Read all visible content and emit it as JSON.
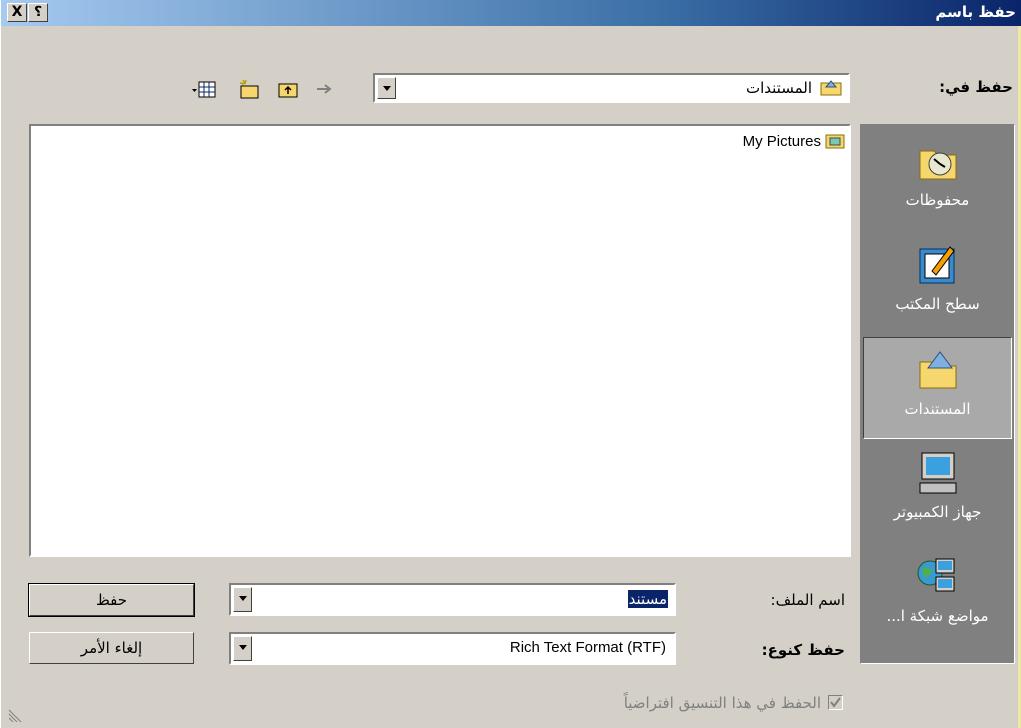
{
  "window": {
    "title": "حفظ باسم",
    "help_button": "؟",
    "close_button": "X"
  },
  "save_in": {
    "label": "حفظ في:",
    "value": "المستندات"
  },
  "files": [
    {
      "name": "My Pictures"
    }
  ],
  "places": [
    {
      "label": "محفوظات",
      "icon": "history-icon"
    },
    {
      "label": "سطح المكتب",
      "icon": "desktop-icon"
    },
    {
      "label": "المستندات",
      "icon": "my-documents-icon",
      "selected": true
    },
    {
      "label": "جهاز الكمبيوتر",
      "icon": "my-computer-icon"
    },
    {
      "label": "مواضع شبكة ا...",
      "icon": "network-places-icon"
    }
  ],
  "filename": {
    "label": "اسم الملف:",
    "value": "مستند"
  },
  "filetype": {
    "label": "حفظ كنوع:",
    "value": "Rich Text Format (RTF)"
  },
  "buttons": {
    "save": "حفظ",
    "cancel": "إلغاء الأمر"
  },
  "default_format": {
    "label": "الحفظ في هذا التنسيق افتراضياً",
    "checked": true
  },
  "colors": {
    "titlebar_start": "#0a246a",
    "titlebar_end": "#a6caf0",
    "face": "#d4d0c8",
    "places_bg": "#808080",
    "selection": "#0a246a"
  }
}
